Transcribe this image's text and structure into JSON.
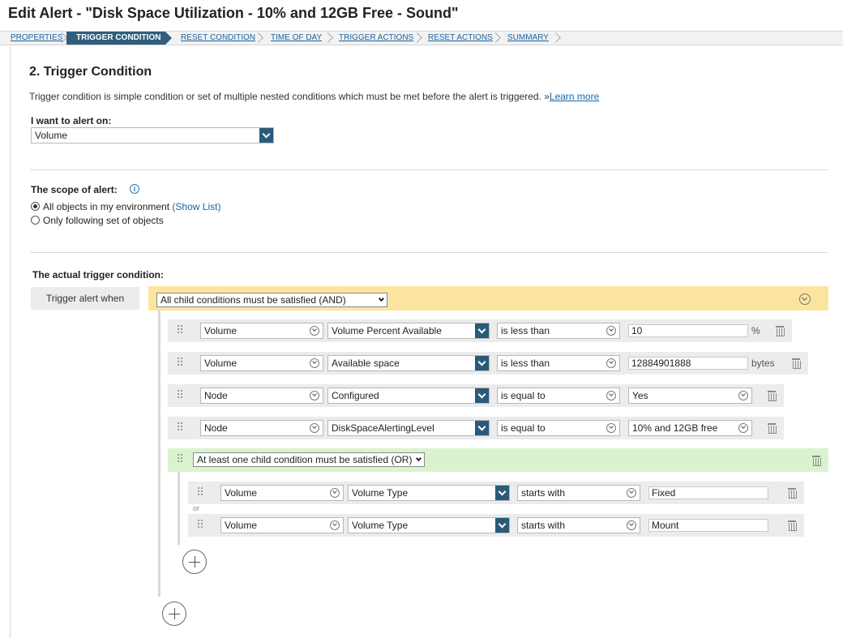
{
  "page": {
    "title": "Edit Alert - \"Disk Space Utilization - 10% and 12GB Free - Sound\""
  },
  "wizard": {
    "steps": [
      "PROPERTIES",
      "TRIGGER CONDITION",
      "RESET CONDITION",
      "TIME OF DAY",
      "TRIGGER ACTIONS",
      "RESET ACTIONS",
      "SUMMARY"
    ],
    "active": "TRIGGER CONDITION"
  },
  "section": {
    "heading": "2. Trigger Condition",
    "description": "Trigger condition is simple condition or set of multiple nested conditions which must be met before the alert is triggered. »",
    "learn_more": "Learn more"
  },
  "alert_on": {
    "label": "I want to alert on:",
    "value": "Volume"
  },
  "scope": {
    "label": "The scope of alert:",
    "options": [
      "All objects in my environment",
      "Only following set of objects"
    ],
    "selected": "All objects in my environment",
    "show_list": "(Show List)"
  },
  "trigger": {
    "label": "The actual trigger condition:",
    "when_label": "Trigger alert when",
    "root_operator": "All child conditions must be satisfied (AND)",
    "conditions": [
      {
        "object": "Volume",
        "field": "Volume Percent Available",
        "operator": "is less than",
        "value": "10",
        "unit": "%"
      },
      {
        "object": "Volume",
        "field": "Available space",
        "operator": "is less than",
        "value": "12884901888",
        "unit": "bytes"
      },
      {
        "object": "Node",
        "field": "Configured",
        "operator": "is equal to",
        "value": "Yes",
        "unit": ""
      },
      {
        "object": "Node",
        "field": "DiskSpaceAlertingLevel",
        "operator": "is equal to",
        "value": "10% and 12GB free",
        "unit": ""
      }
    ],
    "group": {
      "operator": "At least one child condition must be satisfied (OR)",
      "separator": "or",
      "conditions": [
        {
          "object": "Volume",
          "field": "Volume Type",
          "operator": "starts with",
          "value": "Fixed"
        },
        {
          "object": "Volume",
          "field": "Volume Type",
          "operator": "starts with",
          "value": "Mount"
        }
      ]
    }
  },
  "colors": {
    "and_bar": "#fbe59e",
    "or_bar": "#daf3cf",
    "wizard_active": "#2f5f7d",
    "link": "#1a64a3"
  }
}
